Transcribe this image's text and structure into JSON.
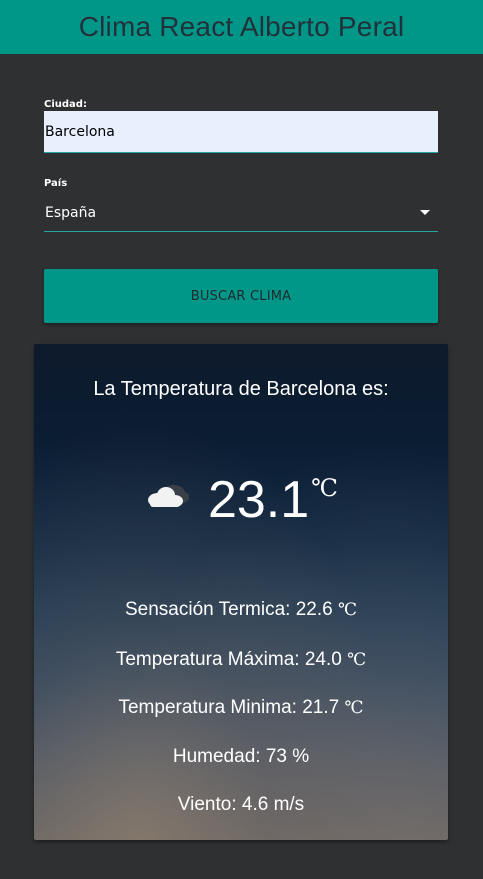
{
  "header": {
    "title": "Clima React Alberto Peral"
  },
  "form": {
    "city_label": "Ciudad:",
    "city_value": "Barcelona",
    "country_label": "País",
    "country_value": "España",
    "search_label": "BUSCAR CLIMA"
  },
  "weather": {
    "heading": "La Temperatura de Barcelona es:",
    "icon": "cloud-icon",
    "temperature": "23.1",
    "unit": "℃",
    "feels_like_label": "Sensación Termica: 22.6",
    "max_label": "Temperatura Máxima: 24.0",
    "min_label": "Temperatura Minima: 21.7",
    "humidity": "Humedad: 73 %",
    "wind": "Viento: 4.6 m/s"
  },
  "colors": {
    "accent": "#009688",
    "background": "#2f3032",
    "input_bg": "#e8f0fe"
  }
}
